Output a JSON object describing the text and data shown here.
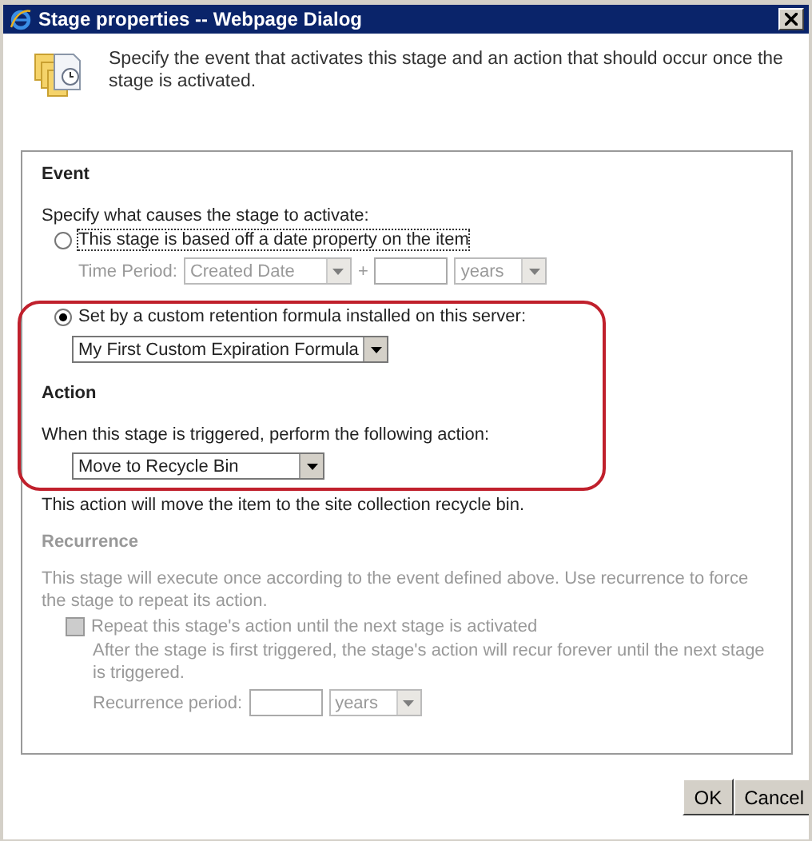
{
  "window": {
    "title": "Stage properties -- Webpage Dialog"
  },
  "header": {
    "description": "Specify the event that activates this stage and an action that should occur once the stage is activated."
  },
  "event": {
    "heading": "Event",
    "prompt": "Specify what causes the stage to activate:",
    "options": [
      {
        "kind": "date",
        "label": "This stage is based off a date property on the item",
        "selected": false
      },
      {
        "kind": "formula",
        "label": "Set by a custom retention formula installed on this server:",
        "selected": true
      }
    ],
    "time_period": {
      "label": "Time Period:",
      "property": "Created Date",
      "plus": "+",
      "unit": "years",
      "disabled": true
    },
    "formula": "My First Custom Expiration Formula"
  },
  "action": {
    "heading": "Action",
    "prompt": "When this stage is triggered, perform the following action:",
    "select": "Move to Recycle Bin",
    "note": "This action will move the item to the site collection recycle bin."
  },
  "recurrence": {
    "heading": "Recurrence",
    "disabled": true,
    "description": "This stage will execute once according to the event defined above. Use recurrence to force the stage to repeat its action.",
    "checkbox": {
      "label": "Repeat this stage's action until the next stage is activated",
      "checked": false
    },
    "detail": "After the stage is first triggered, the stage's action will recur forever until the next stage is triggered.",
    "period_label": "Recurrence period:",
    "unit": "years"
  },
  "buttons": [
    "OK",
    "Cancel"
  ]
}
